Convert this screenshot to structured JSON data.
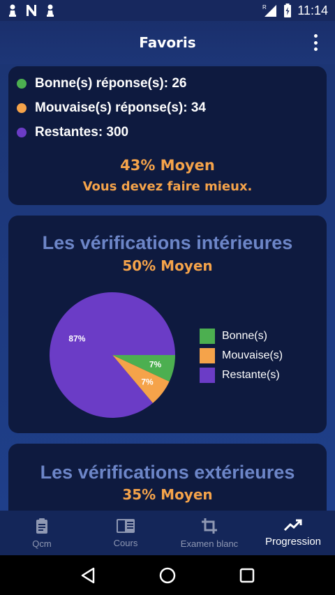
{
  "status_bar": {
    "time": "11:14",
    "icons": [
      "chess-pawn-icon",
      "n-logo-icon",
      "chess-pawn-icon",
      "signal-icon",
      "battery-charging-icon"
    ],
    "signal_badge": "R"
  },
  "app_bar": {
    "title": "Favoris",
    "menu_icon": "more-vert-icon"
  },
  "summary": {
    "legend": [
      {
        "label": "Bonne(s) réponse(s): 26",
        "color": "#4caf50"
      },
      {
        "label": "Mouvaise(s) réponse(s): 34",
        "color": "#f5a34a"
      },
      {
        "label": "Restantes: 300",
        "color": "#6b3cc6"
      }
    ],
    "score": "43% Moyen",
    "message": "Vous devez faire mieux."
  },
  "categories": [
    {
      "title": "Les vérifications intérieures",
      "score": "50% Moyen",
      "chart_data": {
        "type": "pie",
        "labels": [
          "Bonne(s)",
          "Mouvaise(s)",
          "Restante(s)"
        ],
        "values": [
          7,
          7,
          87
        ],
        "value_labels": [
          "7%",
          "7%",
          "87%"
        ],
        "colors": [
          "#4caf50",
          "#f5a34a",
          "#6b3cc6"
        ],
        "legend": "right"
      }
    },
    {
      "title": "Les vérifications extérieures",
      "score": "35% Moyen"
    }
  ],
  "bottom_nav": {
    "items": [
      {
        "label": "Qcm",
        "icon": "clipboard-icon"
      },
      {
        "label": "Cours",
        "icon": "book-icon"
      },
      {
        "label": "Examen blanc",
        "icon": "crop-icon"
      },
      {
        "label": "Progression",
        "icon": "trending-up-icon",
        "active": true
      }
    ]
  },
  "system_nav": [
    "back-icon",
    "home-icon",
    "recents-icon"
  ]
}
